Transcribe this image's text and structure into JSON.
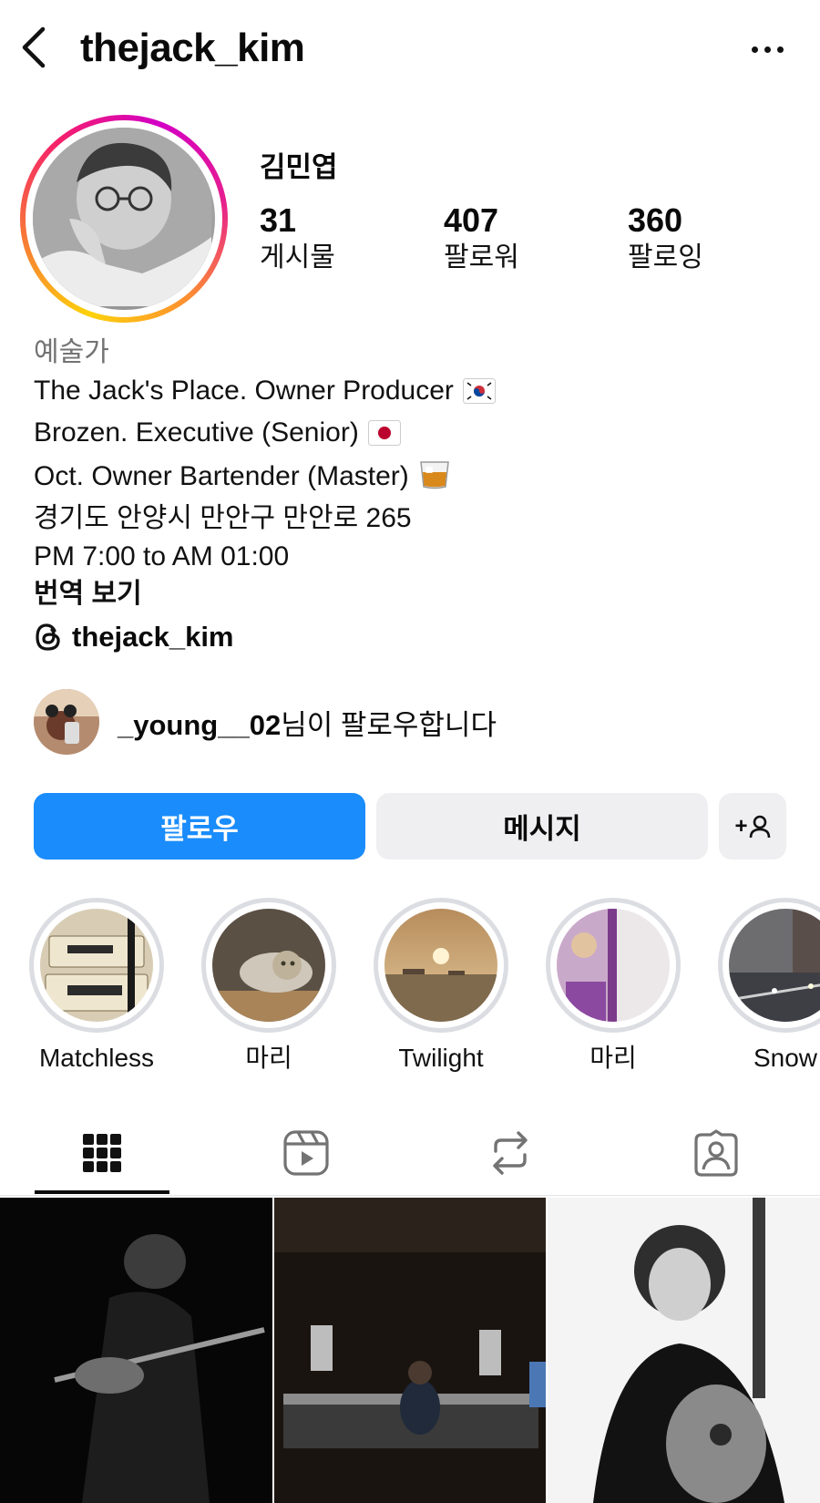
{
  "header": {
    "username": "thejack_kim"
  },
  "profile": {
    "name": "김민엽",
    "stats": [
      {
        "value": "31",
        "label": "게시물"
      },
      {
        "value": "407",
        "label": "팔로워"
      },
      {
        "value": "360",
        "label": "팔로잉"
      }
    ],
    "bio": {
      "category": "예술가",
      "lines": [
        "The Jack's Place. Owner Producer",
        "Brozen. Executive (Senior)",
        "Oct. Owner Bartender (Master)",
        "경기도 안양시 만안구 만안로 265",
        "PM 7:00 to AM 01:00"
      ],
      "translate": "번역 보기"
    },
    "threads_handle": "thejack_kim",
    "followed_by": {
      "user": "_young__02",
      "suffix": "님이 팔로우합니다"
    }
  },
  "actions": {
    "follow": "팔로우",
    "message": "메시지",
    "add_user": "+"
  },
  "highlights": [
    {
      "label": "Matchless"
    },
    {
      "label": "마리"
    },
    {
      "label": "Twilight"
    },
    {
      "label": "마리"
    },
    {
      "label": "Snow"
    }
  ],
  "tabs": [
    {
      "icon": "grid-icon",
      "active": true
    },
    {
      "icon": "reels-icon",
      "active": false
    },
    {
      "icon": "reposts-icon",
      "active": false
    },
    {
      "icon": "tagged-icon",
      "active": false
    }
  ],
  "colors": {
    "follow_button": "#1a8cfb",
    "secondary_button": "#efeff1",
    "category_text": "#737373"
  }
}
